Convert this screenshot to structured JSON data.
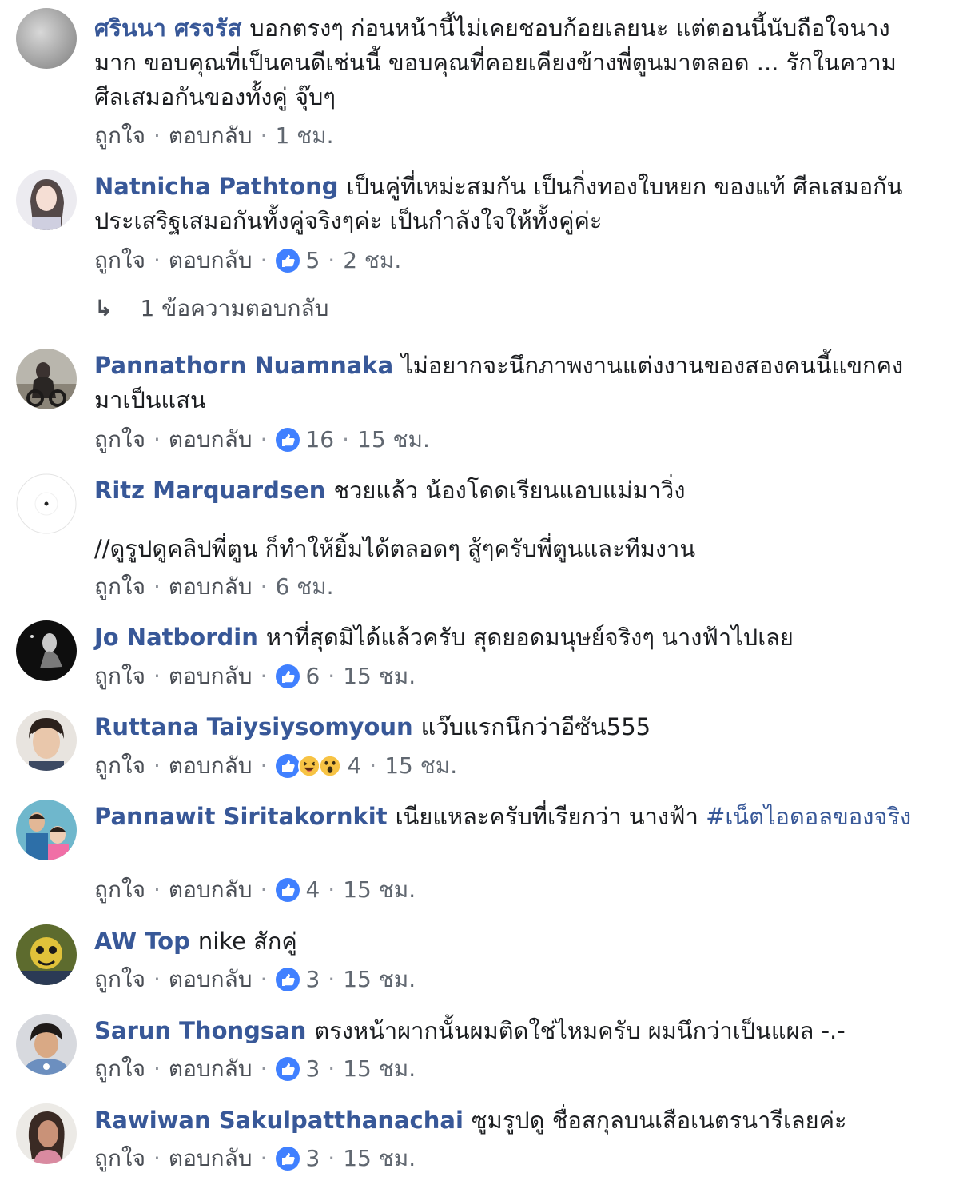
{
  "actions": {
    "like": "ถูกใจ",
    "reply": "ตอบกลับ",
    "separator": "·"
  },
  "colors": {
    "name": "#385898",
    "like_blue": "#4080ff",
    "meta": "#606770"
  },
  "comments": [
    {
      "name": "ศรินนา ศรจรัส",
      "text": "บอกตรงๆ ก่อนหน้านี้ไม่เคยชอบก้อยเลยนะ แต่ตอนนี้นับถือใจนางมาก ขอบคุณที่เป็นคนดีเช่นนี้ ขอบคุณที่คอยเคียงข้างพี่ตูนมาตลอด ... รักในความศีลเสมอกันของทั้งคู่ จุ๊บๆ",
      "reactions": "",
      "time": "1 ชม."
    },
    {
      "name": "Natnicha Pathtong",
      "text": "เป็นคู่ที่เหม่ะสมกัน เป็นกิ่งทองใบหยก ของแท้ ศีลเสมอกัน ประเสริฐเสมอกันทั้งคู่จริงๆค่ะ เป็นกำลังใจให้ทั้งคู่ค่ะ",
      "reactions": "5",
      "time": "2 ชม.",
      "replies_label": "1 ข้อความตอบกลับ"
    },
    {
      "name": "Pannathorn Nuamnaka",
      "text": "ไม่อยากจะนึกภาพงานแต่งงานของสองคนนี้แขกคงมาเป็นแสน",
      "reactions": "16",
      "time": "15 ชม."
    },
    {
      "name": "Ritz Marquardsen",
      "text": "ชวยแล้ว น้องโดดเรียนแอบแม่มาวิ่ง",
      "text2": "//ดูรูปดูคลิปพี่ตูน ก็ทำให้ยิ้มได้ตลอดๆ สู้ๆครับพี่ตูนและทีมงาน",
      "reactions": "",
      "time": "6 ชม."
    },
    {
      "name": "Jo Natbordin",
      "text": "หาที่สุดมิได้แล้วครับ สุดยอดมนุษย์จริงๆ นางฟ้าไปเลย",
      "reactions": "6",
      "time": "15 ชม."
    },
    {
      "name": "Ruttana Taiysiysomyoun",
      "text": "แว๊บแรกนึกว่าอีซัน555",
      "reactions": "4",
      "time": "15 ชม."
    },
    {
      "name": "Pannawit Siritakornkit",
      "text": "เนียแหละครับที่เรียกว่า นางฟ้า",
      "hashtag": "#เน็ตไอดอลของจริง",
      "reactions": "4",
      "time": "15 ชม."
    },
    {
      "name": "AW Top",
      "text": "nike สักคู่",
      "reactions": "3",
      "time": "15 ชม."
    },
    {
      "name": "Sarun Thongsan",
      "text": "ตรงหน้าผากนั้นผมติดใช่ไหมครับ ผมนึกว่าเป็นแผล -.-",
      "reactions": "3",
      "time": "15 ชม."
    },
    {
      "name": "Rawiwan Sakulpatthanachai",
      "text": "ซูมรูปดู ชื่อสกุลบนเสือเนตรนารีเลยค่ะ",
      "reactions": "3",
      "time": "15 ชม."
    }
  ]
}
